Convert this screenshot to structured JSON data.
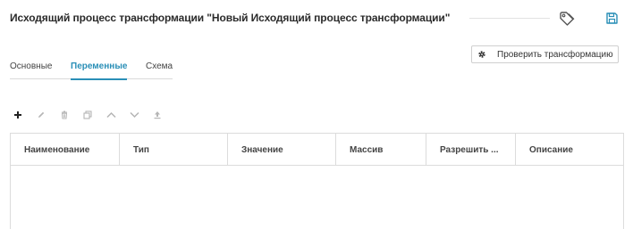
{
  "header": {
    "title": "Исходящий процесс трансформации \"Новый Исходящий процесс трансформации\"",
    "tag_icon": "tag-icon",
    "save_icon": "save-icon"
  },
  "actions": {
    "check_transformation_label": "Проверить трансформацию",
    "check_icon": "gear-icon"
  },
  "tabs": [
    {
      "label": "Основные",
      "active": false
    },
    {
      "label": "Переменные",
      "active": true
    },
    {
      "label": "Схема",
      "active": false
    }
  ],
  "toolbar": {
    "icons": [
      "plus-icon",
      "edit-icon",
      "delete-icon",
      "copy-icon",
      "chevron-up-icon",
      "chevron-down-icon",
      "upload-icon"
    ]
  },
  "table": {
    "columns": [
      "Наименование",
      "Тип",
      "Значение",
      "Массив",
      "Разрешить ...",
      "Описание"
    ],
    "rows": []
  },
  "colors": {
    "accent": "#2a8fb7",
    "text": "#333333",
    "border": "#dcdcdc"
  }
}
